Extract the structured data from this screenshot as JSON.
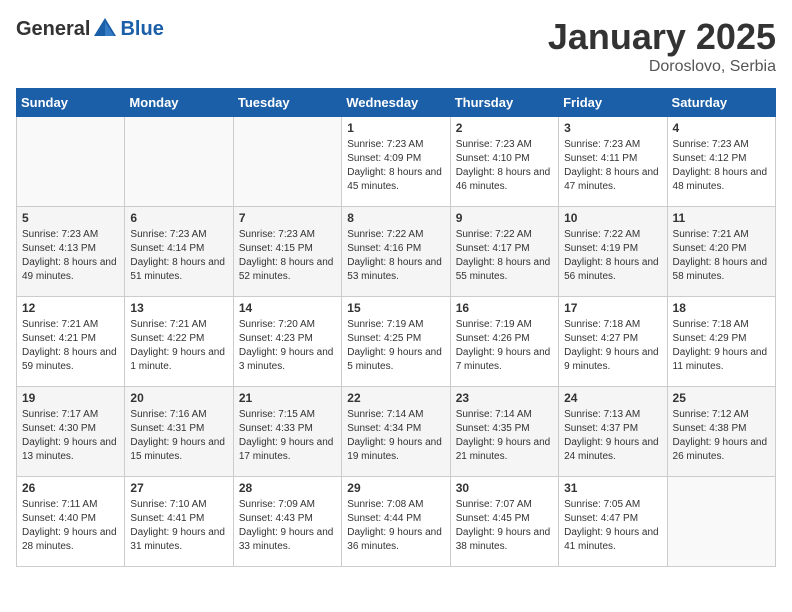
{
  "logo": {
    "general": "General",
    "blue": "Blue"
  },
  "title": "January 2025",
  "subtitle": "Doroslovo, Serbia",
  "days_of_week": [
    "Sunday",
    "Monday",
    "Tuesday",
    "Wednesday",
    "Thursday",
    "Friday",
    "Saturday"
  ],
  "weeks": [
    [
      {
        "day": "",
        "sunrise": "",
        "sunset": "",
        "daylight": ""
      },
      {
        "day": "",
        "sunrise": "",
        "sunset": "",
        "daylight": ""
      },
      {
        "day": "",
        "sunrise": "",
        "sunset": "",
        "daylight": ""
      },
      {
        "day": "1",
        "sunrise": "Sunrise: 7:23 AM",
        "sunset": "Sunset: 4:09 PM",
        "daylight": "Daylight: 8 hours and 45 minutes."
      },
      {
        "day": "2",
        "sunrise": "Sunrise: 7:23 AM",
        "sunset": "Sunset: 4:10 PM",
        "daylight": "Daylight: 8 hours and 46 minutes."
      },
      {
        "day": "3",
        "sunrise": "Sunrise: 7:23 AM",
        "sunset": "Sunset: 4:11 PM",
        "daylight": "Daylight: 8 hours and 47 minutes."
      },
      {
        "day": "4",
        "sunrise": "Sunrise: 7:23 AM",
        "sunset": "Sunset: 4:12 PM",
        "daylight": "Daylight: 8 hours and 48 minutes."
      }
    ],
    [
      {
        "day": "5",
        "sunrise": "Sunrise: 7:23 AM",
        "sunset": "Sunset: 4:13 PM",
        "daylight": "Daylight: 8 hours and 49 minutes."
      },
      {
        "day": "6",
        "sunrise": "Sunrise: 7:23 AM",
        "sunset": "Sunset: 4:14 PM",
        "daylight": "Daylight: 8 hours and 51 minutes."
      },
      {
        "day": "7",
        "sunrise": "Sunrise: 7:23 AM",
        "sunset": "Sunset: 4:15 PM",
        "daylight": "Daylight: 8 hours and 52 minutes."
      },
      {
        "day": "8",
        "sunrise": "Sunrise: 7:22 AM",
        "sunset": "Sunset: 4:16 PM",
        "daylight": "Daylight: 8 hours and 53 minutes."
      },
      {
        "day": "9",
        "sunrise": "Sunrise: 7:22 AM",
        "sunset": "Sunset: 4:17 PM",
        "daylight": "Daylight: 8 hours and 55 minutes."
      },
      {
        "day": "10",
        "sunrise": "Sunrise: 7:22 AM",
        "sunset": "Sunset: 4:19 PM",
        "daylight": "Daylight: 8 hours and 56 minutes."
      },
      {
        "day": "11",
        "sunrise": "Sunrise: 7:21 AM",
        "sunset": "Sunset: 4:20 PM",
        "daylight": "Daylight: 8 hours and 58 minutes."
      }
    ],
    [
      {
        "day": "12",
        "sunrise": "Sunrise: 7:21 AM",
        "sunset": "Sunset: 4:21 PM",
        "daylight": "Daylight: 8 hours and 59 minutes."
      },
      {
        "day": "13",
        "sunrise": "Sunrise: 7:21 AM",
        "sunset": "Sunset: 4:22 PM",
        "daylight": "Daylight: 9 hours and 1 minute."
      },
      {
        "day": "14",
        "sunrise": "Sunrise: 7:20 AM",
        "sunset": "Sunset: 4:23 PM",
        "daylight": "Daylight: 9 hours and 3 minutes."
      },
      {
        "day": "15",
        "sunrise": "Sunrise: 7:19 AM",
        "sunset": "Sunset: 4:25 PM",
        "daylight": "Daylight: 9 hours and 5 minutes."
      },
      {
        "day": "16",
        "sunrise": "Sunrise: 7:19 AM",
        "sunset": "Sunset: 4:26 PM",
        "daylight": "Daylight: 9 hours and 7 minutes."
      },
      {
        "day": "17",
        "sunrise": "Sunrise: 7:18 AM",
        "sunset": "Sunset: 4:27 PM",
        "daylight": "Daylight: 9 hours and 9 minutes."
      },
      {
        "day": "18",
        "sunrise": "Sunrise: 7:18 AM",
        "sunset": "Sunset: 4:29 PM",
        "daylight": "Daylight: 9 hours and 11 minutes."
      }
    ],
    [
      {
        "day": "19",
        "sunrise": "Sunrise: 7:17 AM",
        "sunset": "Sunset: 4:30 PM",
        "daylight": "Daylight: 9 hours and 13 minutes."
      },
      {
        "day": "20",
        "sunrise": "Sunrise: 7:16 AM",
        "sunset": "Sunset: 4:31 PM",
        "daylight": "Daylight: 9 hours and 15 minutes."
      },
      {
        "day": "21",
        "sunrise": "Sunrise: 7:15 AM",
        "sunset": "Sunset: 4:33 PM",
        "daylight": "Daylight: 9 hours and 17 minutes."
      },
      {
        "day": "22",
        "sunrise": "Sunrise: 7:14 AM",
        "sunset": "Sunset: 4:34 PM",
        "daylight": "Daylight: 9 hours and 19 minutes."
      },
      {
        "day": "23",
        "sunrise": "Sunrise: 7:14 AM",
        "sunset": "Sunset: 4:35 PM",
        "daylight": "Daylight: 9 hours and 21 minutes."
      },
      {
        "day": "24",
        "sunrise": "Sunrise: 7:13 AM",
        "sunset": "Sunset: 4:37 PM",
        "daylight": "Daylight: 9 hours and 24 minutes."
      },
      {
        "day": "25",
        "sunrise": "Sunrise: 7:12 AM",
        "sunset": "Sunset: 4:38 PM",
        "daylight": "Daylight: 9 hours and 26 minutes."
      }
    ],
    [
      {
        "day": "26",
        "sunrise": "Sunrise: 7:11 AM",
        "sunset": "Sunset: 4:40 PM",
        "daylight": "Daylight: 9 hours and 28 minutes."
      },
      {
        "day": "27",
        "sunrise": "Sunrise: 7:10 AM",
        "sunset": "Sunset: 4:41 PM",
        "daylight": "Daylight: 9 hours and 31 minutes."
      },
      {
        "day": "28",
        "sunrise": "Sunrise: 7:09 AM",
        "sunset": "Sunset: 4:43 PM",
        "daylight": "Daylight: 9 hours and 33 minutes."
      },
      {
        "day": "29",
        "sunrise": "Sunrise: 7:08 AM",
        "sunset": "Sunset: 4:44 PM",
        "daylight": "Daylight: 9 hours and 36 minutes."
      },
      {
        "day": "30",
        "sunrise": "Sunrise: 7:07 AM",
        "sunset": "Sunset: 4:45 PM",
        "daylight": "Daylight: 9 hours and 38 minutes."
      },
      {
        "day": "31",
        "sunrise": "Sunrise: 7:05 AM",
        "sunset": "Sunset: 4:47 PM",
        "daylight": "Daylight: 9 hours and 41 minutes."
      },
      {
        "day": "",
        "sunrise": "",
        "sunset": "",
        "daylight": ""
      }
    ]
  ]
}
